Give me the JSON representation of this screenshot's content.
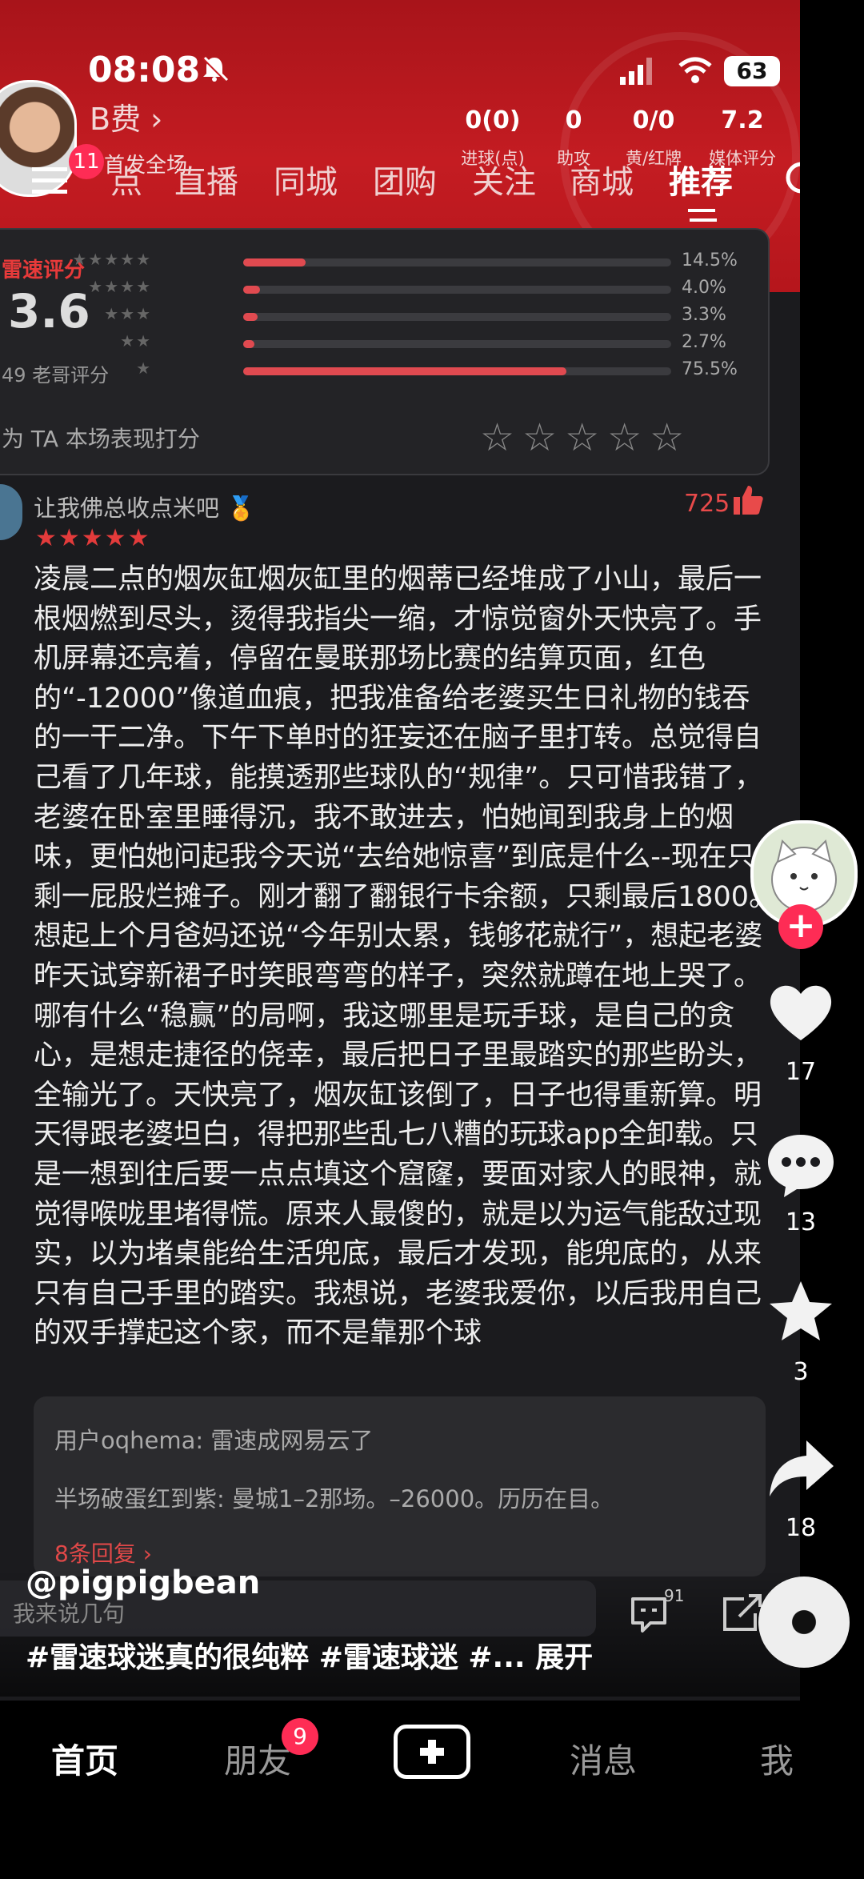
{
  "status_bar": {
    "time": "08:08",
    "battery": "63"
  },
  "match_header": {
    "player_name": "B费",
    "notification_badge": "11",
    "first_start_label": "首发全场",
    "stats": [
      {
        "value": "0(0)",
        "label": "进球(点)"
      },
      {
        "value": "0",
        "label": "助攻"
      },
      {
        "value": "0/0",
        "label": "黄/红牌"
      },
      {
        "value": "7.2",
        "label": "媒体评分"
      }
    ]
  },
  "top_nav": {
    "tabs": [
      "点",
      "直播",
      "同城",
      "团购",
      "关注",
      "商城",
      "推荐"
    ],
    "active": "推荐"
  },
  "rating": {
    "title": "雷速评分",
    "score": "3.6",
    "count_label": "49 老哥评分",
    "rate_prompt": "为 TA 本场表现打分",
    "distribution": [
      {
        "stars": "★★★★★",
        "percent_label": "14.5%",
        "fraction": 0.145
      },
      {
        "stars": "★★★★",
        "percent_label": "4.0%",
        "fraction": 0.04
      },
      {
        "stars": "★★★",
        "percent_label": "3.3%",
        "fraction": 0.033
      },
      {
        "stars": "★★",
        "percent_label": "2.7%",
        "fraction": 0.027
      },
      {
        "stars": "★",
        "percent_label": "75.5%",
        "fraction": 0.755
      }
    ],
    "empty_stars": "☆☆☆☆☆"
  },
  "comment": {
    "username": "让我佛总收点米吧 🏅",
    "likes": "725",
    "stars": "★★★★★",
    "body": "凌晨二点的烟灰缸烟灰缸里的烟蒂已经堆成了小山，最后一根烟燃到尽头，烫得我指尖一缩，才惊觉窗外天快亮了。手机屏幕还亮着，停留在曼联那场比赛的结算页面，红色的“-12000”像道血痕，把我准备给老婆买生日礼物的钱吞的一干二净。下午下单时的狂妄还在脑子里打转。总觉得自己看了几年球，能摸透那些球队的“规律”。只可惜我错了，老婆在卧室里睡得沉，我不敢进去，怕她闻到我身上的烟味，更怕她问起我今天说“去给她惊喜”到底是什么--现在只剩一屁股烂摊子。刚才翻了翻银行卡余额，只剩最后1800。想起上个月爸妈还说“今年别太累，钱够花就行”，想起老婆昨天试穿新裙子时笑眼弯弯的样子，突然就蹲在地上哭了。哪有什么“稳赢”的局啊，我这哪里是玩手球，是自己的贪心，是想走捷径的侥幸，最后把日子里最踏实的那些盼头，全输光了。天快亮了，烟灰缸该倒了，日子也得重新算。明天得跟老婆坦白，得把那些乱七八糟的玩球app全卸载。只是一想到往后要一点点填这个窟窿，要面对家人的眼神，就觉得喉咙里堵得慌。原来人最傻的，就是以为运气能敌过现实，以为堵桌能给生活兜底，最后才发现，能兜底的，从来只有自己手里的踏实。我想说，老婆我爱你，以后我用自己的双手撑起这个家，而不是靠那个球",
    "replies": [
      "用户oqhema: 雷速成网易云了",
      "半场破蛋红到紫: 曼城1–2那场。–26000。历历在目。"
    ],
    "more_replies": "8条回复 ›"
  },
  "video": {
    "handle": "@pigpigbean",
    "input_placeholder": "我来说几句",
    "emoji_count": "91",
    "hashtags": "#雷速球迷真的很纯粹 #雷速球迷 #...  展开"
  },
  "actions": {
    "likes": "17",
    "comments": "13",
    "favorites": "3",
    "shares": "18"
  },
  "bottom_tabs": {
    "home": "首页",
    "friends": "朋友",
    "friends_badge": "9",
    "messages": "消息",
    "me": "我"
  },
  "colors": {
    "accent": "#fe2c55",
    "header_red": "#c41c22",
    "rating_red": "#e04a50"
  }
}
